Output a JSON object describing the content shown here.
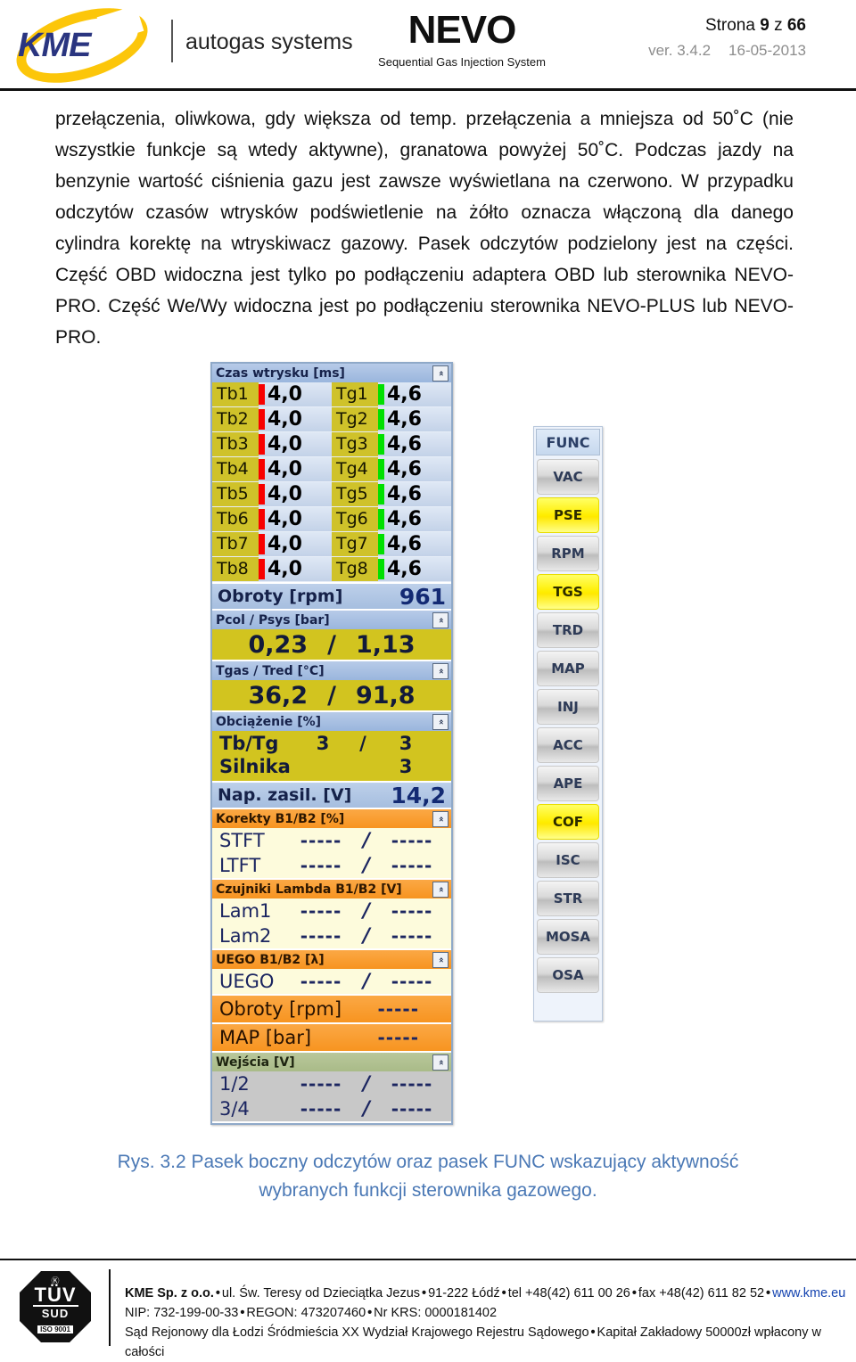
{
  "header": {
    "brand_logo": "KME",
    "brand_tagline": "autogas systems",
    "product_logo": "NEVO",
    "product_subtitle": "Sequential Gas Injection System",
    "page_label": "Strona",
    "page_number": "9",
    "page_of": "z",
    "page_total": "66",
    "version": "ver. 3.4.2",
    "date": "16-05-2013"
  },
  "body": {
    "paragraph": "przełączenia, oliwkowa, gdy większa od temp. przełączenia a mniejsza od 50˚C (nie wszystkie funkcje są wtedy aktywne), granatowa powyżej 50˚C. Podczas jazdy na benzynie wartość ciśnienia gazu jest zawsze wyświetlana na czerwono. W przypadku odczytów czasów wtrysków podświetlenie na żółto oznacza włączoną dla danego cylindra korektę na wtryskiwacz gazowy. Pasek odczytów podzielony jest na części. Część OBD widoczna jest tylko po podłączeniu adaptera OBD lub sterownika NEVO-PRO. Część We/Wy widoczna jest po podłączeniu sterownika NEVO-PLUS lub NEVO-PRO."
  },
  "panel": {
    "injection": {
      "title": "Czas wtrysku [ms]",
      "petrol": [
        {
          "label": "Tb1",
          "value": "4,0"
        },
        {
          "label": "Tb2",
          "value": "4,0"
        },
        {
          "label": "Tb3",
          "value": "4,0"
        },
        {
          "label": "Tb4",
          "value": "4,0"
        },
        {
          "label": "Tb5",
          "value": "4,0"
        },
        {
          "label": "Tb6",
          "value": "4,0"
        },
        {
          "label": "Tb7",
          "value": "4,0"
        },
        {
          "label": "Tb8",
          "value": "4,0"
        }
      ],
      "gas": [
        {
          "label": "Tg1",
          "value": "4,6"
        },
        {
          "label": "Tg2",
          "value": "4,6"
        },
        {
          "label": "Tg3",
          "value": "4,6"
        },
        {
          "label": "Tg4",
          "value": "4,6"
        },
        {
          "label": "Tg5",
          "value": "4,6"
        },
        {
          "label": "Tg6",
          "value": "4,6"
        },
        {
          "label": "Tg7",
          "value": "4,6"
        },
        {
          "label": "Tg8",
          "value": "4,6"
        }
      ],
      "petrol_bar_color": "#f80000",
      "gas_bar_color": "#00e000"
    },
    "rpm": {
      "label": "Obroty [rpm]",
      "value": "961"
    },
    "pressure": {
      "title": "Pcol / Psys [bar]",
      "value_a": "0,23",
      "separator": "/",
      "value_b": "1,13"
    },
    "temperature": {
      "title": "Tgas / Tred [°C]",
      "value_a": "36,2",
      "separator": "/",
      "value_b": "91,8"
    },
    "load": {
      "title": "Obciążenie [%]",
      "row1": {
        "label": "Tb/Tg",
        "value_a": "3",
        "separator": "/",
        "value_b": "3"
      },
      "row2": {
        "label": "Silnika",
        "value_b": "3"
      }
    },
    "voltage": {
      "label": "Nap. zasil. [V]",
      "value": "14,2"
    },
    "corrections": {
      "title": "Korekty B1/B2 [%]",
      "rows": [
        {
          "label": "STFT",
          "value_a": "-----",
          "separator": "/",
          "value_b": "-----"
        },
        {
          "label": "LTFT",
          "value_a": "-----",
          "separator": "/",
          "value_b": "-----"
        }
      ]
    },
    "lambda": {
      "title": "Czujniki Lambda B1/B2 [V]",
      "rows": [
        {
          "label": "Lam1",
          "value_a": "-----",
          "separator": "/",
          "value_b": "-----"
        },
        {
          "label": "Lam2",
          "value_a": "-----",
          "separator": "/",
          "value_b": "-----"
        }
      ]
    },
    "uego": {
      "title": "UEGO B1/B2 [λ]",
      "rows": [
        {
          "label": "UEGO",
          "value_a": "-----",
          "separator": "/",
          "value_b": "-----"
        }
      ]
    },
    "obd_rpm": {
      "label": "Obroty [rpm]",
      "value": "-----"
    },
    "obd_map": {
      "label": "MAP [bar]",
      "value": "-----"
    },
    "inputs": {
      "title": "Wejścia [V]",
      "rows": [
        {
          "label": "1/2",
          "value_a": "-----",
          "separator": "/",
          "value_b": "-----"
        },
        {
          "label": "3/4",
          "value_a": "-----",
          "separator": "/",
          "value_b": "-----"
        }
      ]
    }
  },
  "func_panel": {
    "title": "FUNC",
    "buttons": [
      {
        "label": "VAC",
        "active": false
      },
      {
        "label": "PSE",
        "active": true
      },
      {
        "label": "RPM",
        "active": false
      },
      {
        "label": "TGS",
        "active": true
      },
      {
        "label": "TRD",
        "active": false
      },
      {
        "label": "MAP",
        "active": false
      },
      {
        "label": "INJ",
        "active": false
      },
      {
        "label": "ACC",
        "active": false
      },
      {
        "label": "APE",
        "active": false
      },
      {
        "label": "COF",
        "active": true
      },
      {
        "label": "ISC",
        "active": false
      },
      {
        "label": "STR",
        "active": false
      },
      {
        "label": "MOSA",
        "active": false
      },
      {
        "label": "OSA",
        "active": false
      }
    ],
    "active_color": "#ffee00",
    "inactive_color": "#d9d9d9"
  },
  "caption": {
    "text": "Rys. 3.2 Pasek boczny odczytów oraz pasek FUNC wskazujący aktywność wybranych funkcji sterownika gazowego."
  },
  "footer": {
    "certification": {
      "top": "Ⓚ",
      "main": "TÜV",
      "sub": "SUD",
      "iso": "ISO 9001"
    },
    "line1_company": "KME Sp. z o.o.",
    "line1_rest": "ul. Św. Teresy od Dzieciątka Jezus",
    "line1_city": "91-222 Łódź",
    "line1_tel": "tel +48(42) 611 00 26",
    "line1_fax": "fax +48(42) 611 82 52",
    "line1_web": "www.kme.eu",
    "line2": "NIP: 732-199-00-33",
    "line2b": "REGON: 473207460",
    "line2c": "Nr KRS: 0000181402",
    "line3": "Sąd Rejonowy dla Łodzi Śródmieścia XX Wydział Krajowego Rejestru Sądowego",
    "line3b": "Kapitał Zakładowy 50000zł wpłacony w całości"
  }
}
